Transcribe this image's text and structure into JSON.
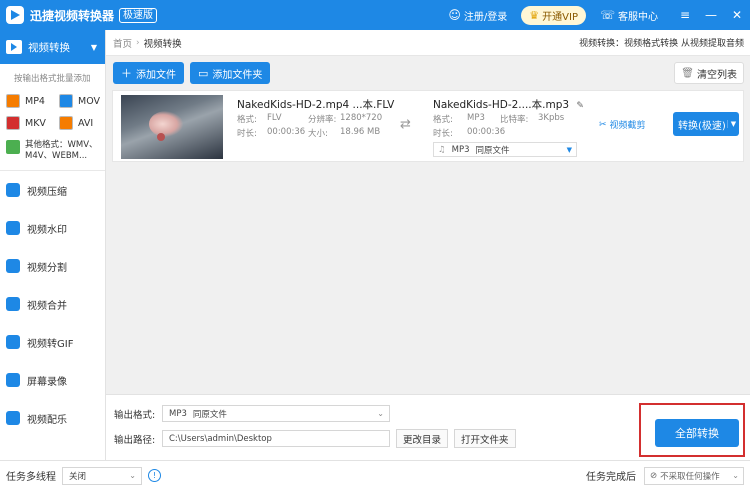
{
  "colors": {
    "accent": "#1e88e5",
    "highlight": "#d32f2f"
  },
  "titlebar": {
    "app_title": "迅捷视频转换器",
    "badge": "极速版",
    "login": "注册/登录",
    "vip": "开通VIP",
    "support": "客服中心",
    "menu_icon": "≡",
    "minimize_icon": "—",
    "close_icon": "✕"
  },
  "sidebar": {
    "active": "视频转换",
    "batch_hint": "按输出格式批量添加",
    "formats": [
      {
        "label": "MP4",
        "color": "#f57c00"
      },
      {
        "label": "MOV",
        "color": "#1e88e5"
      },
      {
        "label": "MKV",
        "color": "#d32f2f"
      },
      {
        "label": "AVI",
        "color": "#f57c00"
      }
    ],
    "other_formats": "其他格式：WMV、M4V、WEBM...",
    "items": [
      {
        "label": "视频压缩",
        "color": "#1e88e5"
      },
      {
        "label": "视频水印",
        "color": "#1e88e5"
      },
      {
        "label": "视频分割",
        "color": "#1e88e5"
      },
      {
        "label": "视频合并",
        "color": "#1e88e5"
      },
      {
        "label": "视频转GIF",
        "color": "#1e88e5"
      },
      {
        "label": "屏幕录像",
        "color": "#1e88e5"
      },
      {
        "label": "视频配乐",
        "color": "#1e88e5"
      }
    ]
  },
  "breadcrumb": {
    "home": "首页",
    "separator": "›",
    "current": "视频转换",
    "tip": "视频转换：视频格式转换 从视频提取音频"
  },
  "toolbar": {
    "add_file": "添加文件",
    "add_folder": "添加文件夹",
    "clear_list": "清空列表"
  },
  "file": {
    "source_name": "NakedKids-HD-2.mp4 ...本.FLV",
    "format_label": "格式:",
    "format_value": "FLV",
    "resolution_label": "分辨率:",
    "resolution_value": "1280*720",
    "duration_label": "时长:",
    "duration_value": "00:00:36",
    "size_label": "大小:",
    "size_value": "18.96 MB",
    "target_name": "NakedKids-HD-2....本.mp3",
    "target_format_value": "MP3",
    "bitrate_label": "比特率:",
    "bitrate_value": "3Kpbs",
    "target_duration_value": "00:00:36",
    "target_select": "MP3",
    "target_select_sub": "同原文件",
    "clip_link": "视频截剪",
    "convert_button": "转换(极速)"
  },
  "bottom": {
    "output_format_label": "输出格式:",
    "output_format_value": "MP3",
    "output_format_sub": "同原文件",
    "output_path_label": "输出路径:",
    "output_path_value": "C:\\Users\\admin\\Desktop",
    "change_dir": "更改目录",
    "open_folder": "打开文件夹",
    "convert_all": "全部转换"
  },
  "statusbar": {
    "multithread_label": "任务多线程",
    "multithread_value": "关闭",
    "info_icon": "!",
    "after_label": "任务完成后",
    "after_value": "不采取任何操作"
  }
}
